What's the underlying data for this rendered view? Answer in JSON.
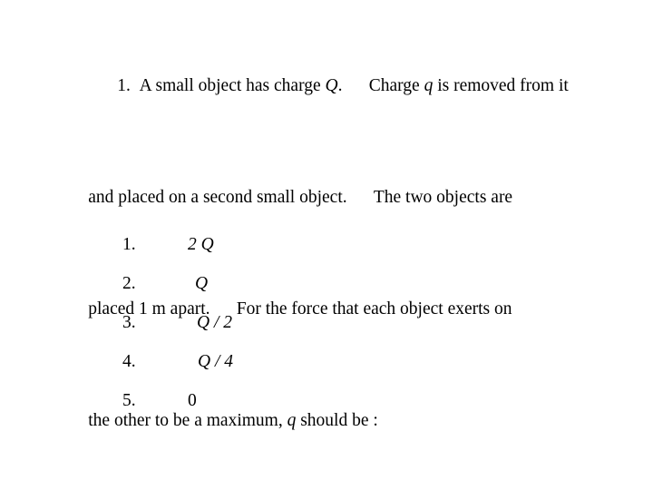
{
  "slide": {
    "background_color": "#ffffff",
    "text_color": "#000000"
  },
  "question": {
    "number": "1.",
    "lines": [
      {
        "segments": [
          {
            "text": "A small object has charge ",
            "italic": false
          },
          {
            "text": "Q",
            "italic": true
          },
          {
            "text": ".  Charge ",
            "italic": false
          },
          {
            "text": "q",
            "italic": true
          },
          {
            "text": " is removed from it",
            "italic": false
          }
        ]
      },
      {
        "segments": [
          {
            "text": "and placed on a second small object.  The two objects are",
            "italic": false
          }
        ]
      },
      {
        "segments": [
          {
            "text": "placed 1 m apart.  For the force that each object exerts on",
            "italic": false
          }
        ]
      },
      {
        "segments": [
          {
            "text": "the other to be a maximum, ",
            "italic": false
          },
          {
            "text": "q",
            "italic": true
          },
          {
            "text": " should be :",
            "italic": false
          }
        ]
      }
    ],
    "plain_text": "1. A small object has charge Q. Charge q is removed from it and placed on a second small object. The two objects are placed 1 m apart. For the force that each object exerts on the other to be a maximum, q should be :"
  },
  "options": [
    {
      "number": "1.",
      "value": "2 Q",
      "italic": true
    },
    {
      "number": "2.",
      "value": "Q",
      "italic": true
    },
    {
      "number": "3.",
      "value": "Q / 2",
      "italic": true
    },
    {
      "number": "4.",
      "value": "Q / 4",
      "italic": true
    },
    {
      "number": "5.",
      "value": "0",
      "italic": false
    }
  ]
}
